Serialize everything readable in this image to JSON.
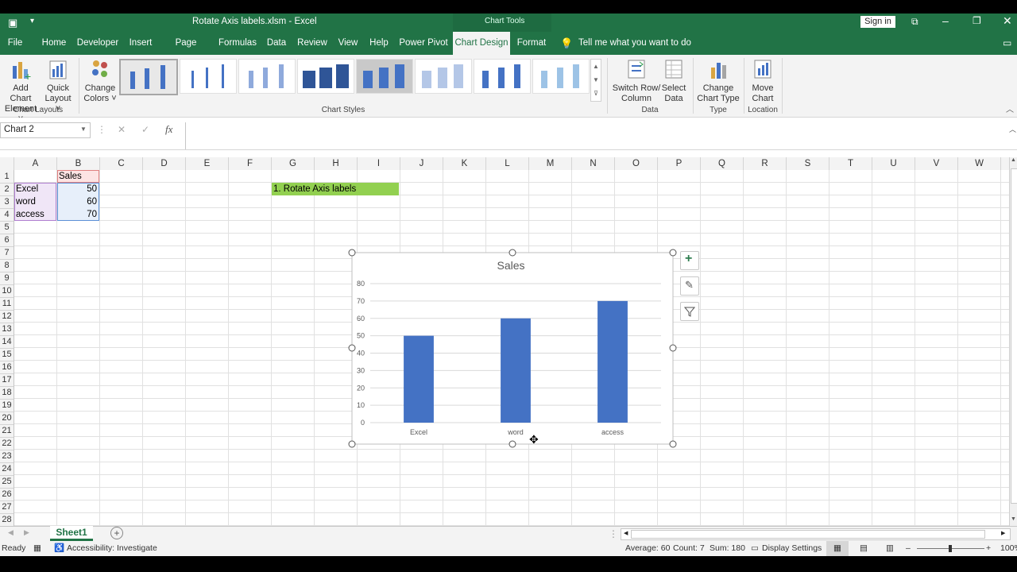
{
  "window": {
    "title": "Rotate Axis labels.xlsm  -  Excel",
    "context_title": "Chart Tools",
    "sign_in": "Sign in"
  },
  "tabs": [
    "File",
    "Home",
    "Developer",
    "Insert",
    "Page Layout",
    "Formulas",
    "Data",
    "Review",
    "View",
    "Help",
    "Power Pivot",
    "Chart Design",
    "Format"
  ],
  "tell_me": "Tell me what you want to do",
  "ribbon": {
    "add_chart_element": [
      "Add Chart",
      "Element ˅"
    ],
    "quick_layout": [
      "Quick",
      "Layout ˅"
    ],
    "change_colors": [
      "Change",
      "Colors ˅"
    ],
    "switch_row_col": [
      "Switch Row/",
      "Column"
    ],
    "select_data": [
      "Select",
      "Data"
    ],
    "change_chart_type": [
      "Change",
      "Chart Type"
    ],
    "move_chart": [
      "Move",
      "Chart"
    ],
    "groups": {
      "chart_layouts": "Chart Layouts",
      "chart_styles": "Chart Styles",
      "data": "Data",
      "type": "Type",
      "location": "Location"
    }
  },
  "formula_bar": {
    "name_box": "Chart 2",
    "fx": "fx",
    "value": ""
  },
  "columns": [
    "A",
    "B",
    "C",
    "D",
    "E",
    "F",
    "G",
    "H",
    "I",
    "J",
    "K",
    "L",
    "M",
    "N",
    "O",
    "P",
    "Q",
    "R",
    "S",
    "T",
    "U",
    "V",
    "W"
  ],
  "rows": [
    "1",
    "2",
    "3",
    "4",
    "5",
    "6",
    "7",
    "8",
    "9",
    "10",
    "11",
    "12",
    "13",
    "14",
    "15",
    "16",
    "17",
    "18",
    "19",
    "20",
    "21",
    "22",
    "23",
    "24",
    "25",
    "26",
    "27",
    "28"
  ],
  "cells": {
    "B1": "Sales",
    "A2": "Excel",
    "B2": "50",
    "A3": "word",
    "B3": "60",
    "A4": "access",
    "B4": "70",
    "G2": "1. Rotate Axis labels"
  },
  "chart_data": {
    "type": "bar",
    "title": "Sales",
    "categories": [
      "Excel",
      "word",
      "access"
    ],
    "series": [
      {
        "name": "Sales",
        "values": [
          50,
          60,
          70
        ]
      }
    ],
    "yticks": [
      "0",
      "10",
      "20",
      "30",
      "40",
      "50",
      "60",
      "70",
      "80"
    ],
    "ylim": [
      0,
      80
    ],
    "grid": true,
    "color": "#4472c4"
  },
  "sheets": [
    "Sheet1"
  ],
  "status": {
    "ready": "Ready",
    "accessibility": "Accessibility: Investigate",
    "average": "Average: 60",
    "count": "Count: 7",
    "sum": "Sum: 180",
    "display_settings": "Display Settings",
    "zoom": "100%"
  }
}
